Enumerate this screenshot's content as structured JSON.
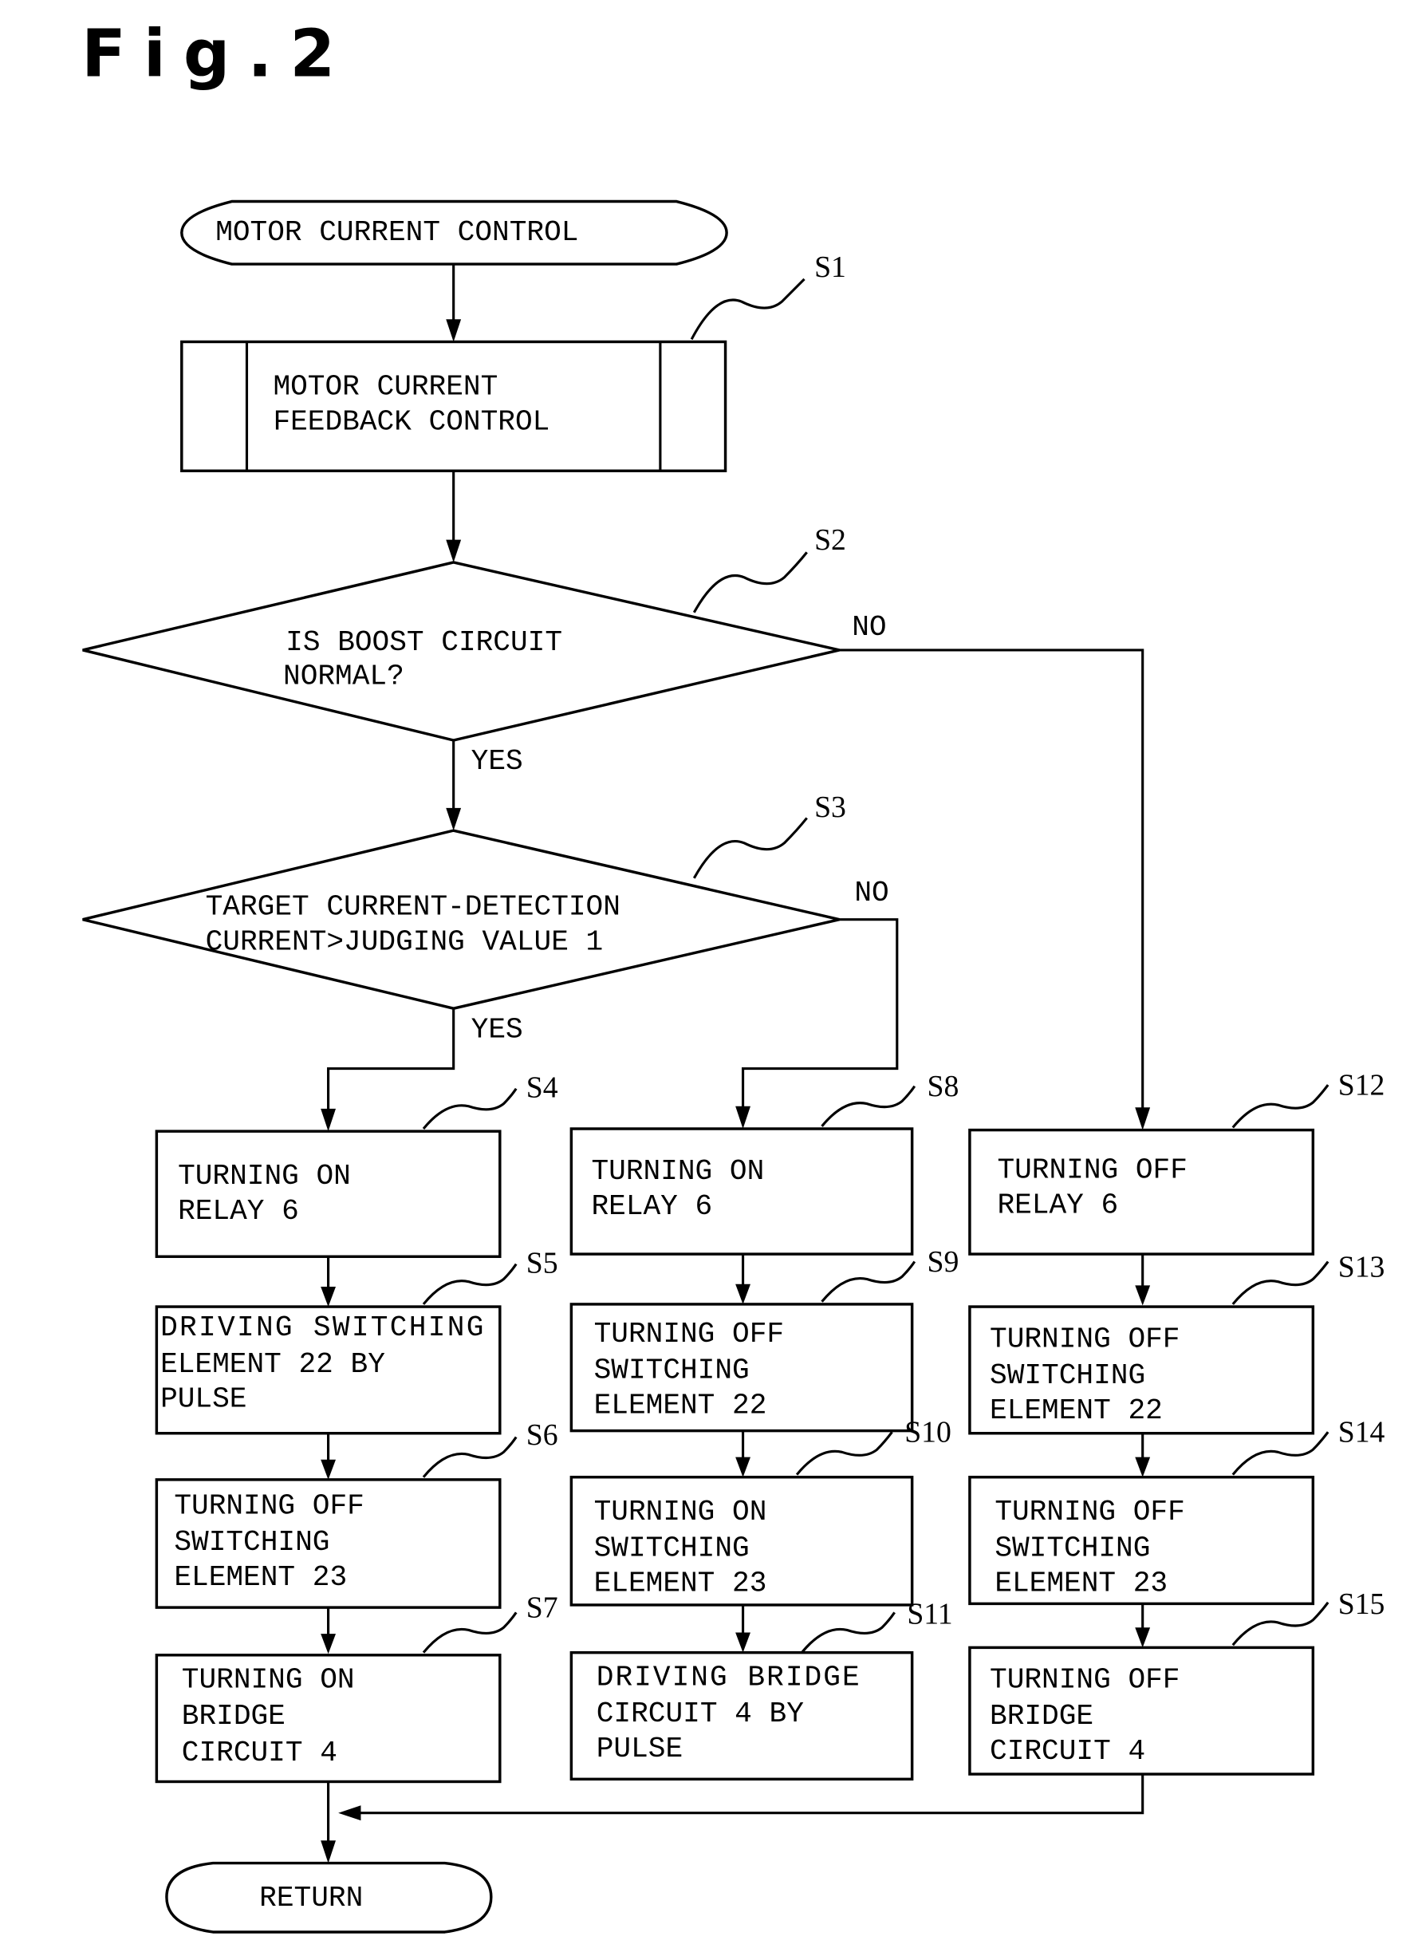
{
  "figure_label": "Fig.2",
  "start": "MOTOR CURRENT CONTROL",
  "end": "RETURN",
  "steps": {
    "S1": {
      "id": "S1",
      "lines": [
        "MOTOR CURRENT",
        "FEEDBACK CONTROL"
      ]
    },
    "S2": {
      "id": "S2",
      "lines": [
        "IS BOOST CIRCUIT",
        "NORMAL?"
      ]
    },
    "S3": {
      "id": "S3",
      "lines": [
        "TARGET CURRENT-DETECTION",
        "CURRENT>JUDGING VALUE 1"
      ]
    },
    "S4": {
      "id": "S4",
      "lines": [
        "TURNING ON",
        "RELAY 6"
      ]
    },
    "S5": {
      "id": "S5",
      "lines": [
        "DRIVING SWITCHING",
        "ELEMENT 22 BY",
        "PULSE"
      ]
    },
    "S6": {
      "id": "S6",
      "lines": [
        "TURNING OFF",
        "SWITCHING",
        "ELEMENT 23"
      ]
    },
    "S7": {
      "id": "S7",
      "lines": [
        "TURNING ON",
        "BRIDGE",
        "CIRCUIT 4"
      ]
    },
    "S8": {
      "id": "S8",
      "lines": [
        "TURNING ON",
        "RELAY 6"
      ]
    },
    "S9": {
      "id": "S9",
      "lines": [
        "TURNING OFF",
        "SWITCHING",
        "ELEMENT 22"
      ]
    },
    "S10": {
      "id": "S10",
      "lines": [
        "TURNING ON",
        "SWITCHING",
        "ELEMENT 23"
      ]
    },
    "S11": {
      "id": "S11",
      "lines": [
        "DRIVING BRIDGE",
        "CIRCUIT 4 BY",
        "PULSE"
      ]
    },
    "S12": {
      "id": "S12",
      "lines": [
        "TURNING OFF",
        "RELAY 6"
      ]
    },
    "S13": {
      "id": "S13",
      "lines": [
        "TURNING OFF",
        "SWITCHING",
        "ELEMENT 22"
      ]
    },
    "S14": {
      "id": "S14",
      "lines": [
        "TURNING OFF",
        "SWITCHING",
        "ELEMENT 23"
      ]
    },
    "S15": {
      "id": "S15",
      "lines": [
        "TURNING OFF",
        "BRIDGE",
        "CIRCUIT 4"
      ]
    }
  },
  "branch_labels": {
    "yes": "YES",
    "no": "NO"
  }
}
